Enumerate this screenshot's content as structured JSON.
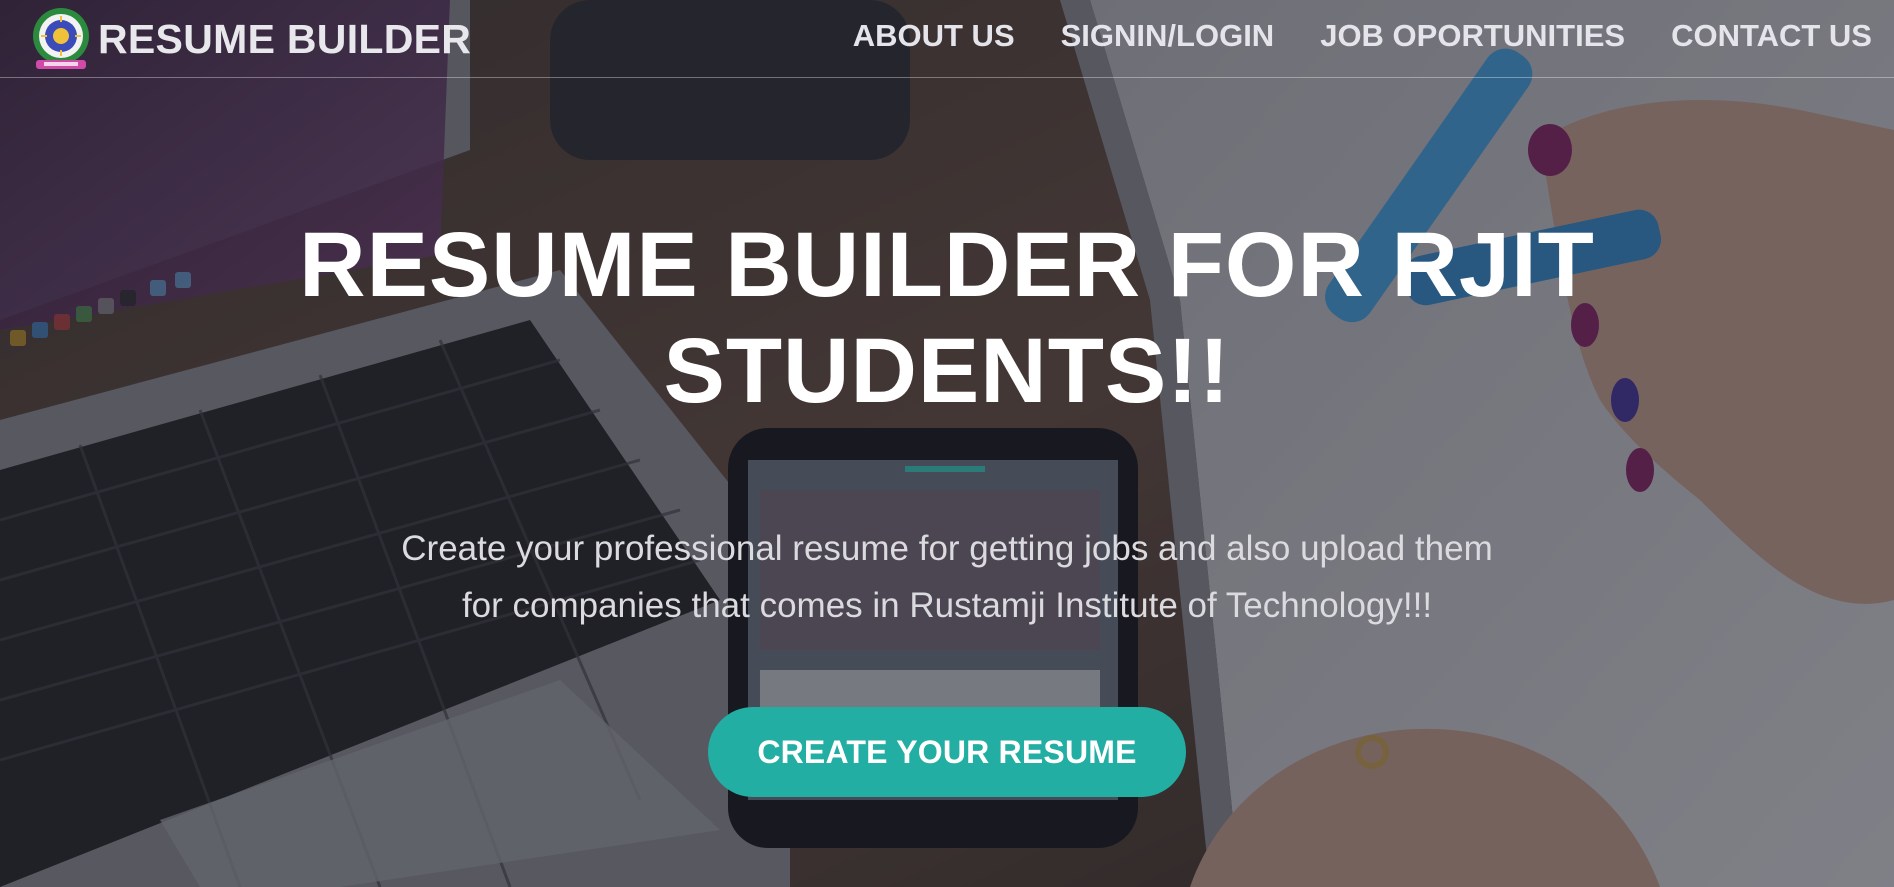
{
  "navbar": {
    "brand_text": "RESUME BUILDER",
    "links": [
      {
        "label": "ABOUT US"
      },
      {
        "label": "SIGNIN/LOGIN"
      },
      {
        "label": "JOB OPORTUNITIES"
      },
      {
        "label": "CONTACT US"
      }
    ]
  },
  "hero": {
    "title_line1": "RESUME BUILDER FOR RJIT",
    "title_line2": "STUDENTS!!",
    "subtitle_line1": "Create your professional resume for getting jobs and also upload them",
    "subtitle_line2": "for companies that comes in Rustamji Institute of Technology!!!",
    "cta_label": "CREATE YOUR RESUME"
  },
  "colors": {
    "accent": "#23aea3",
    "nav_text": "#e4e4ea",
    "title_text": "#ffffff"
  },
  "icons": {
    "logo": "college-emblem-icon"
  }
}
